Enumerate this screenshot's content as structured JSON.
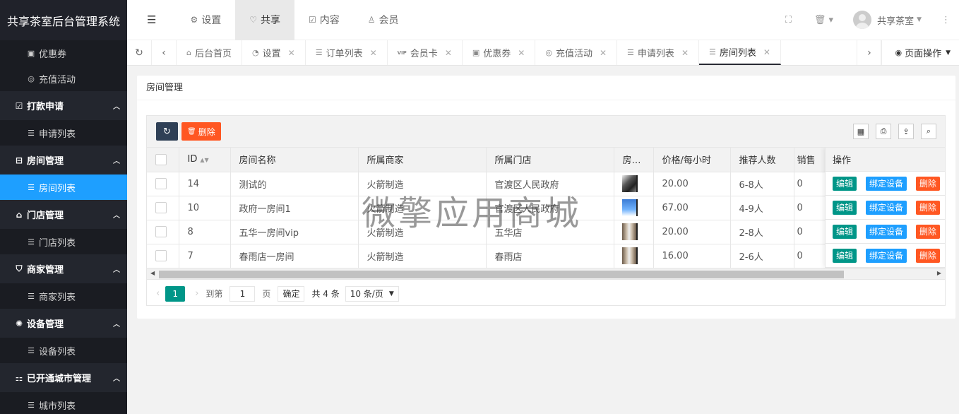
{
  "app": {
    "title": "共享茶室后台管理系统"
  },
  "sidebar": {
    "items": [
      {
        "type": "sub",
        "icon": "▣",
        "label": "优惠券"
      },
      {
        "type": "sub",
        "icon": "◎",
        "label": "充值活动"
      },
      {
        "type": "group",
        "icon": "☑",
        "label": "打款申请"
      },
      {
        "type": "sub",
        "icon": "☰",
        "label": "申请列表"
      },
      {
        "type": "group",
        "icon": "⊟",
        "label": "房间管理"
      },
      {
        "type": "sub",
        "icon": "☰",
        "label": "房间列表",
        "active": true
      },
      {
        "type": "group",
        "icon": "⌂",
        "label": "门店管理"
      },
      {
        "type": "sub",
        "icon": "☰",
        "label": "门店列表"
      },
      {
        "type": "group",
        "icon": "⛉",
        "label": "商家管理"
      },
      {
        "type": "sub",
        "icon": "☰",
        "label": "商家列表"
      },
      {
        "type": "group",
        "icon": "✺",
        "label": "设备管理"
      },
      {
        "type": "sub",
        "icon": "☰",
        "label": "设备列表"
      },
      {
        "type": "group",
        "icon": "⚏",
        "label": "已开通城市管理"
      },
      {
        "type": "sub",
        "icon": "☰",
        "label": "城市列表"
      }
    ]
  },
  "header": {
    "menu": [
      {
        "icon": "⚙",
        "label": "设置"
      },
      {
        "icon": "♡",
        "label": "共享",
        "active": true
      },
      {
        "icon": "☑",
        "label": "内容"
      },
      {
        "icon": "♙",
        "label": "会员"
      }
    ],
    "user_name": "共享茶室"
  },
  "tabs": [
    {
      "icon": "⌂",
      "label": "后台首页",
      "closable": false
    },
    {
      "icon": "◔",
      "label": "设置",
      "closable": true
    },
    {
      "icon": "☰",
      "label": "订单列表",
      "closable": true
    },
    {
      "icon": "VIP",
      "label": "会员卡",
      "closable": true
    },
    {
      "icon": "▣",
      "label": "优惠券",
      "closable": true
    },
    {
      "icon": "◎",
      "label": "充值活动",
      "closable": true
    },
    {
      "icon": "☰",
      "label": "申请列表",
      "closable": true
    },
    {
      "icon": "☰",
      "label": "房间列表",
      "closable": true,
      "active": true
    }
  ],
  "page_ops_label": "页面操作",
  "card": {
    "title": "房间管理"
  },
  "toolbar": {
    "delete_label": "删除"
  },
  "table": {
    "columns": [
      "ID",
      "房间名称",
      "所属商家",
      "所属门店",
      "房…",
      "价格/每小时",
      "推荐人数",
      "销售"
    ],
    "op_header": "操作",
    "rows": [
      {
        "id": "14",
        "name": "测试的",
        "merchant": "火箭制造",
        "store": "官渡区人民政府",
        "image": "dog",
        "price": "20.00",
        "people": "6-8人",
        "sales": "0"
      },
      {
        "id": "10",
        "name": "政府一房间1",
        "merchant": "火箭制造",
        "store": "官渡区人民政府",
        "image": "sky",
        "price": "67.00",
        "people": "4-9人",
        "sales": "0"
      },
      {
        "id": "8",
        "name": "五华一房间vip",
        "merchant": "火箭制造",
        "store": "五华店",
        "image": "room",
        "price": "20.00",
        "people": "2-8人",
        "sales": "0"
      },
      {
        "id": "7",
        "name": "春雨店一房间",
        "merchant": "火箭制造",
        "store": "春雨店",
        "image": "room",
        "price": "16.00",
        "people": "2-6人",
        "sales": "0"
      }
    ],
    "actions": {
      "edit": "编辑",
      "bind": "绑定设备",
      "delete": "删除"
    }
  },
  "pager": {
    "current": "1",
    "goto_label": "到第",
    "goto_value": "1",
    "page_label": "页",
    "confirm_label": "确定",
    "total_label": "共 4 条",
    "page_size_label": "10 条/页"
  },
  "watermark": "微擎应用商城",
  "colors": {
    "sidebar_bg": "#20222a",
    "active_blue": "#1e9fff",
    "green": "#009688",
    "orange": "#ff5722",
    "navy": "#2f4056"
  }
}
